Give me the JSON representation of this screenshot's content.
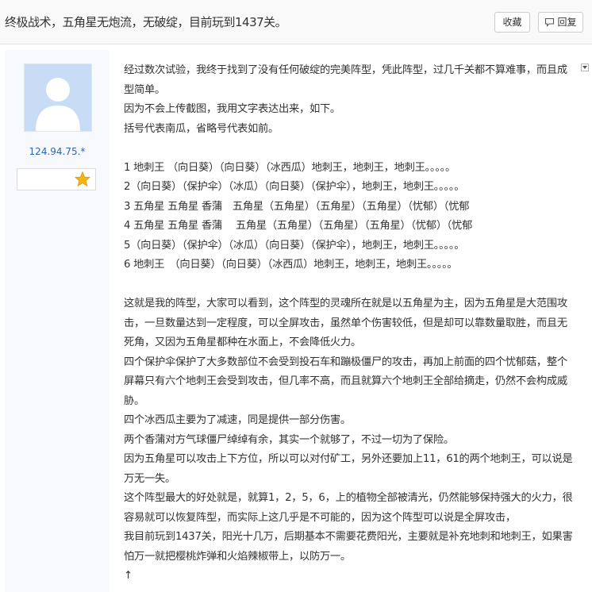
{
  "thread": {
    "title": "终极战术，五角星无炮流，无破绽，目前玩到1437关。",
    "favorite_label": "收藏",
    "reply_label": "回复"
  },
  "author": {
    "ip": "124.94.75.*"
  },
  "post": {
    "paragraphs": [
      "经过数次试验，我终于找到了没有任何破绽的完美阵型，凭此阵型，过几千关都不算难事，而且成型简单。",
      "因为不会上传截图，我用文字表达出来，如下。",
      "括号代表南瓜，省略号代表如前。",
      "",
      "1 地刺王 （向日葵）（向日葵）（冰西瓜）地刺王，地刺王，地刺王。。。。。",
      "2（向日葵）（保护伞）（冰瓜）（向日葵）（保护伞），地刺王，地刺王。。。。。",
      "3 五角星 五角星 香蒲　五角星（五角星）（五角星）（五角星）（忧郁）（忧郁",
      "4 五角星 五角星 香蒲　 五角星（五角星）（五角星）（五角星）（忧郁）（忧郁",
      "5（向日葵）（保护伞）（冰瓜）（向日葵）（保护伞），地刺王，地刺王。。。。。",
      "6 地刺王　（向日葵）（向日葵）（冰西瓜）地刺王，地刺王，地刺王。。。。。",
      "",
      "这就是我的阵型，大家可以看到，这个阵型的灵魂所在就是以五角星为主，因为五角星是大范围攻击，一旦数量达到一定程度，可以全屏攻击，虽然单个伤害较低，但是却可以靠数量取胜，而且无死角，又因为五角星都种在水面上，不会降低火力。",
      "四个保护伞保护了大多数部位不会受到投石车和蹦极僵尸的攻击，再加上前面的四个忧郁菇，整个屏幕只有六个地刺王会受到攻击，但几率不高，而且就算六个地刺王全部给摘走，仍然不会构成威胁。",
      "四个冰西瓜主要为了减速，同是提供一部分伤害。",
      "两个香蒲对方气球僵尸绰绰有余，其实一个就够了，不过一切为了保险。",
      "因为五角星可以攻击上下方位，所以可以对付矿工，另外还要加上11，61的两个地刺王，可以说是万无一失。",
      "这个阵型最大的好处就是，就算1，2，5，6，上的植物全部被清光，仍然能够保持强大的火力，很容易就可以恢复阵型，而实际上这几乎是不可能的，因为这个阵型可以说是全屏攻击，",
      "我目前玩到1437关，阳光十几万，后期基本不需要花费阳光，主要就是补充地刺和地刺王，如果害怕万一就把樱桃炸弹和火焰辣椒带上，以防万一。",
      "↑"
    ]
  },
  "icons": {
    "reply": "comment-bubble-icon",
    "badge": "star-icon",
    "collapse": "collapse-arrow-icon"
  },
  "colors": {
    "link": "#2d64b3",
    "avatar": "#c9dcf5",
    "star": "#f5b516"
  }
}
